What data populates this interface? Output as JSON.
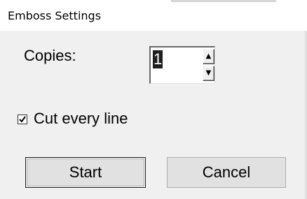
{
  "window": {
    "title": "Emboss Settings"
  },
  "copies": {
    "label": "Copies:",
    "value": "1",
    "up_glyph": "▲",
    "down_glyph": "▼"
  },
  "cut_every_line": {
    "label": "Cut every line",
    "checked": true
  },
  "buttons": {
    "start": "Start",
    "cancel": "Cancel"
  },
  "icons": {
    "spin_up": "spin-up-arrow-icon",
    "spin_down": "spin-down-arrow-icon",
    "checkbox_check": "checkmark-icon"
  },
  "colors": {
    "title_bg": "#ffffff",
    "dialog_bg": "#f0f0f0",
    "button_face": "#e1e1e1",
    "selection_bg": "#1f1f1f"
  }
}
